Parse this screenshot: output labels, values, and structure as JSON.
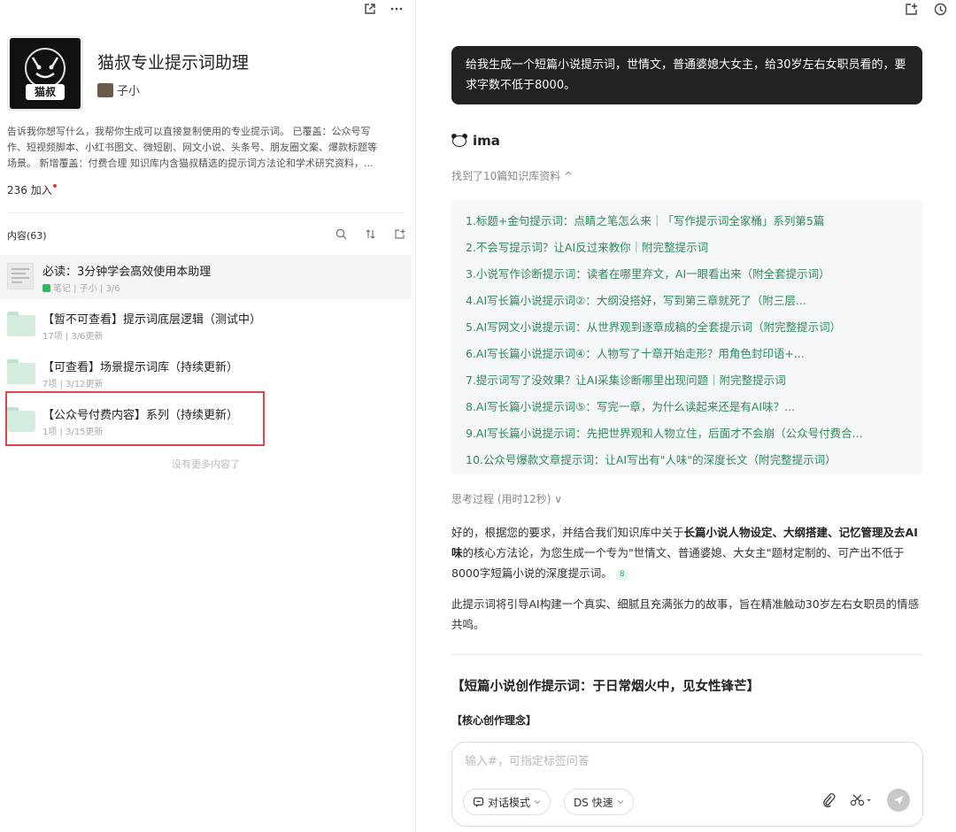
{
  "left": {
    "kb": {
      "title": "猫叔专业提示词助理",
      "avatar_text": "猫叔",
      "owner": "子小",
      "description_line1": "告诉我你想写什么，我帮你生成可以直接复制使用的专业提示词。 已覆盖：公众号写",
      "description_line2": "作、短视频脚本、小红书图文、微短剧、网文小说、头条号、朋友圈文案、爆款标题等",
      "description_line3": "场景。 新增覆盖：付费合理 知识库内含猫叔精选的提示词方法论和学术研究资料，...",
      "join_count": "236 加入"
    },
    "content_label": "内容(63)",
    "items": [
      {
        "title": "必读：3分钟学会高效使用本助理",
        "meta": "笔记 | 子小 | 3/6"
      },
      {
        "title": "【暂不可查看】提示词底层逻辑（测试中）",
        "meta": "17项 | 3/6更新"
      },
      {
        "title": "【可查看】场景提示词库（持续更新）",
        "meta": "7项 | 3/12更新"
      },
      {
        "title": "【公众号付费内容】系列（持续更新）",
        "meta": "1项 | 3/15更新"
      }
    ],
    "no_more": "没有更多内容了"
  },
  "right": {
    "user_message": "给我生成一个短篇小说提示词，世情文，普通婆媳大女主，给30岁左右女职员看的，要求字数不低于8000。",
    "bot_name": "ima",
    "found_text": "找到了10篇知识库资料 ^",
    "refs": [
      "1.标题+金句提示词：点睛之笔怎么来｜「写作提示词全家桶」系列第5篇",
      "2.不会写提示词？让AI反过来教你｜附完整提示词",
      "3.小说写作诊断提示词：读者在哪里弃文，AI一眼看出来（附全套提示词）",
      "4.AI写长篇小说提示词②：大纲没搭好，写到第三章就死了（附三层...",
      "5.AI写网文小说提示词：从世界观到逐章成稿的全套提示词（附完整提示词）",
      "6.AI写长篇小说提示词④：人物写了十章开始走形？用角色封印语+...",
      "7.提示词写了没效果？让AI采集诊断哪里出现问题｜附完整提示词",
      "8.AI写长篇小说提示词⑤：写完一章，为什么读起来还是有AI味？...",
      "9.AI写长篇小说提示词：先把世界观和人物立住，后面才不会崩（公众号付费合...",
      "10.公众号爆款文章提示词：让AI写出有\"人味\"的深度长文（附完整提示词）"
    ],
    "think_text": "思考过程 (用时12秒) ∨",
    "para1_a": "好的，根据您的要求，并结合我们知识库中关于",
    "para1_b": "长篇小说人物设定、大纲搭建、记忆管理及去AI味",
    "para1_c": "的核心方法论，为您生成一个专为\"世情文、普通婆媳、大女主\"题材定制的、可产出不低于8000字短篇小说的深度提示词。",
    "para1_cite": "8",
    "para2": "此提示词将引导AI构建一个真实、细腻且充满张力的故事，旨在精准触动30岁左右女职员的情感共鸣。",
    "prompt_title": "【短篇小说创作提示词：于日常烟火中，见女性锋芒】",
    "prompt_sub": "【核心创作理念】",
    "composer": {
      "placeholder": "输入#，可指定标签问答",
      "mode_label": "对话模式",
      "model_label": "DS 快速"
    }
  },
  "colors": {
    "ref_green": "#2f8a5c",
    "highlight_red": "#e0464b",
    "bubble_dark": "#222222"
  }
}
